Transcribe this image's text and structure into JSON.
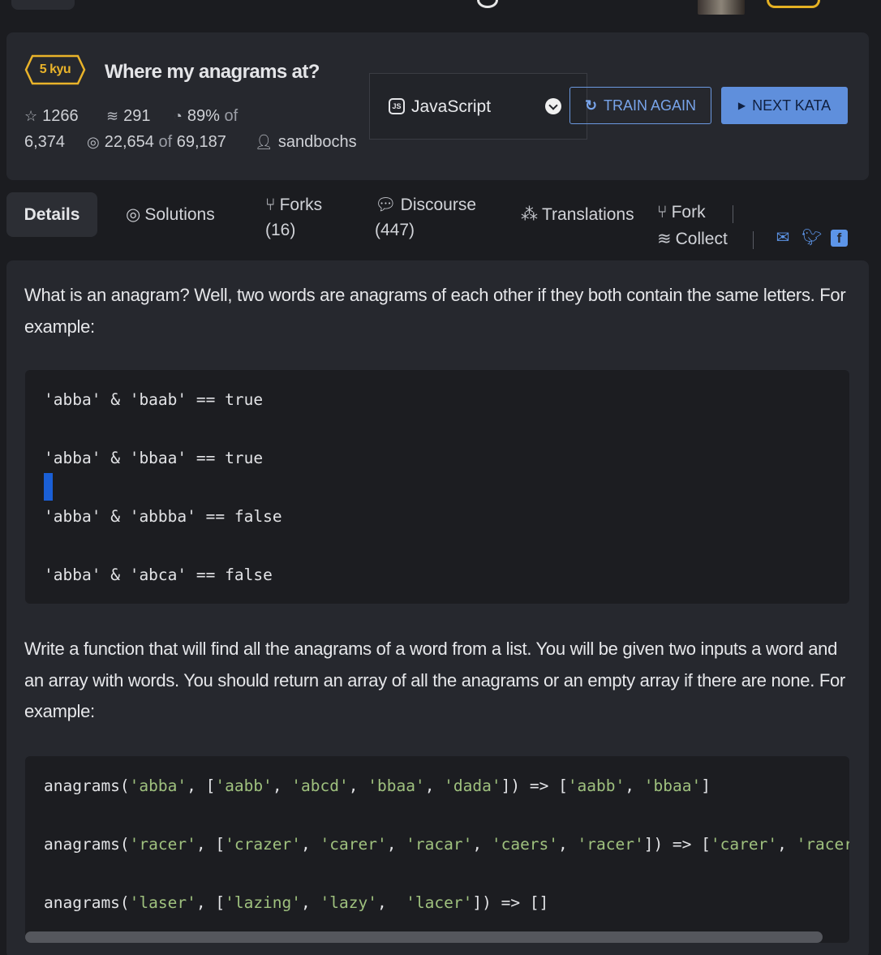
{
  "kata": {
    "rank": "5 kyu",
    "title": "Where my anagrams at?",
    "stars": "1266",
    "collections": "291",
    "satisfaction": "89%",
    "satisfaction_of": "of",
    "votes": "6,374",
    "completed": "22,654",
    "completed_of": "of",
    "attempted": "69,187",
    "author": "sandbochs"
  },
  "language_select": {
    "icon": "js-icon",
    "value": "JavaScript"
  },
  "buttons": {
    "train_again": "TRAIN AGAIN",
    "next_kata": "NEXT KATA"
  },
  "tabs": {
    "details": "Details",
    "solutions": "Solutions",
    "forks": "Forks",
    "forks_count": "(16)",
    "discourse": "Discourse",
    "discourse_count": "(447)",
    "translations": "Translations",
    "fork": "Fork",
    "collect": "Collect"
  },
  "description": {
    "intro": "What is an anagram? Well, two words are anagrams of each other if they both contain the same letters. For example:",
    "example1": [
      {
        "a": "'abba'",
        "op": "&",
        "b": "'baab'",
        "eq": "==",
        "r": "true"
      },
      {
        "a": "'abba'",
        "op": "&",
        "b": "'bbaa'",
        "eq": "==",
        "r": "true"
      },
      {
        "a": "'abba'",
        "op": "&",
        "b": "'abbba'",
        "eq": "==",
        "r": "false"
      },
      {
        "a": "'abba'",
        "op": "&",
        "b": "'abca'",
        "eq": "==",
        "r": "false"
      }
    ],
    "task": "Write a function that will find all the anagrams of a word from a list. You will be given two inputs a word and an array with words. You should return an array of all the anagrams or an empty array if there are none. For example:",
    "example2": [
      "anagrams('abba', ['aabb', 'abcd', 'bbaa', 'dada']) => ['aabb', 'bbaa']",
      "anagrams('racer', ['crazer', 'carer', 'racar', 'caers', 'racer']) => ['carer', 'racer'",
      "anagrams('laser', ['lazing', 'lazy',  'lacer']) => []"
    ]
  },
  "colors": {
    "rank": "#e9b32a",
    "accent": "#5f8fdc",
    "string": "#9fc17e"
  }
}
